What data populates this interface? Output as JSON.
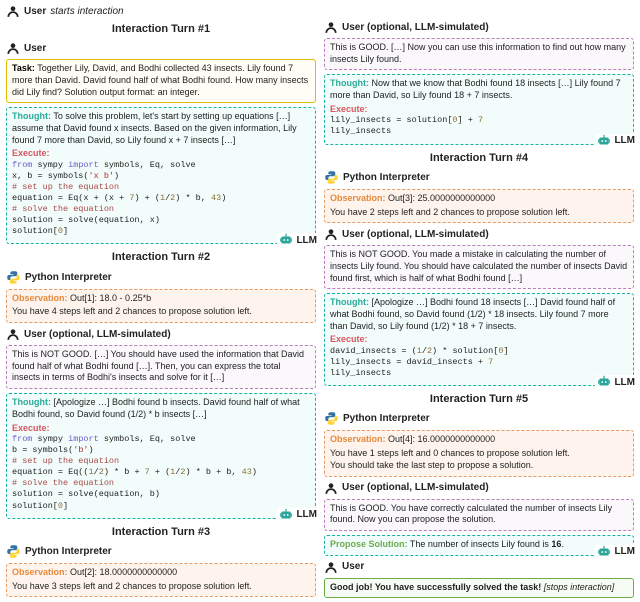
{
  "top": {
    "user_label": "User",
    "starts": "starts interaction"
  },
  "roles": {
    "user": "User",
    "llm": "LLM",
    "python": "Python Interpreter",
    "user_sim": "User (optional, LLM-simulated)"
  },
  "labels": {
    "task": "Task:",
    "thought": "Thought:",
    "execute": "Execute:",
    "observation": "Observation:",
    "propose": "Propose Solution:"
  },
  "turns": {
    "t1": "Interaction Turn #1",
    "t2": "Interaction Turn #2",
    "t3": "Interaction Turn #3",
    "t4": "Interaction Turn #4",
    "t5": "Interaction Turn #5"
  },
  "task": "Together Lily, David, and Bodhi collected 43 insects. Lily found 7 more than David. David found half of what Bodhi found. How many insects did Lily find? Solution output format: an integer.",
  "t1": {
    "thought": "To solve this problem, let's start by setting up equations […] assume that David found x insects. Based on the given information, Lily found 7 more than David, so Lily found x + 7 insects […]",
    "code": [
      {
        "t": "kw",
        "v": "from"
      },
      {
        "t": "p",
        "v": " sympy "
      },
      {
        "t": "kw",
        "v": "import"
      },
      {
        "t": "p",
        "v": " symbols, Eq, solve\n"
      },
      {
        "t": "p",
        "v": "x, b = symbols("
      },
      {
        "t": "str",
        "v": "'x b'"
      },
      {
        "t": "p",
        "v": ")\n"
      },
      {
        "t": "cmt",
        "v": "# set up the equation"
      },
      {
        "t": "p",
        "v": "\n"
      },
      {
        "t": "p",
        "v": "equation = Eq(x + (x + "
      },
      {
        "t": "num",
        "v": "7"
      },
      {
        "t": "p",
        "v": ") + ("
      },
      {
        "t": "num",
        "v": "1"
      },
      {
        "t": "p",
        "v": "/"
      },
      {
        "t": "num",
        "v": "2"
      },
      {
        "t": "p",
        "v": ") * b, "
      },
      {
        "t": "num",
        "v": "43"
      },
      {
        "t": "p",
        "v": ")\n"
      },
      {
        "t": "cmt",
        "v": "# solve the equation"
      },
      {
        "t": "p",
        "v": "\n"
      },
      {
        "t": "p",
        "v": "solution = solve(equation, x)\n"
      },
      {
        "t": "p",
        "v": "solution["
      },
      {
        "t": "num",
        "v": "0"
      },
      {
        "t": "p",
        "v": "]"
      }
    ]
  },
  "t2": {
    "obs": "Out[1]: 18.0 - 0.25*b",
    "steps": "You have 4 steps left and 2 chances to propose solution left.",
    "feedback": "This is NOT GOOD. […] You should have used the information that David found half of what Bodhi found […]. Then, you can express the total insects in terms of Bodhi's insects and solve for it […]",
    "thought": "[Apologize …] Bodhi found b insects. David found half of what Bodhi found, so David found (1/2) * b insects […]",
    "code": [
      {
        "t": "kw",
        "v": "from"
      },
      {
        "t": "p",
        "v": " sympy "
      },
      {
        "t": "kw",
        "v": "import"
      },
      {
        "t": "p",
        "v": " symbols, Eq, solve\n"
      },
      {
        "t": "p",
        "v": "b = symbols("
      },
      {
        "t": "str",
        "v": "'b'"
      },
      {
        "t": "p",
        "v": ")\n"
      },
      {
        "t": "cmt",
        "v": "# set up the equation"
      },
      {
        "t": "p",
        "v": "\n"
      },
      {
        "t": "p",
        "v": "equation = Eq(("
      },
      {
        "t": "num",
        "v": "1"
      },
      {
        "t": "p",
        "v": "/"
      },
      {
        "t": "num",
        "v": "2"
      },
      {
        "t": "p",
        "v": ") * b + "
      },
      {
        "t": "num",
        "v": "7"
      },
      {
        "t": "p",
        "v": " + ("
      },
      {
        "t": "num",
        "v": "1"
      },
      {
        "t": "p",
        "v": "/"
      },
      {
        "t": "num",
        "v": "2"
      },
      {
        "t": "p",
        "v": ") * b + b, "
      },
      {
        "t": "num",
        "v": "43"
      },
      {
        "t": "p",
        "v": ")\n"
      },
      {
        "t": "cmt",
        "v": "# solve the equation"
      },
      {
        "t": "p",
        "v": "\n"
      },
      {
        "t": "p",
        "v": "solution = solve(equation, b)\n"
      },
      {
        "t": "p",
        "v": "solution["
      },
      {
        "t": "num",
        "v": "0"
      },
      {
        "t": "p",
        "v": "]"
      }
    ]
  },
  "t3": {
    "obs": "Out[2]: 18.0000000000000",
    "steps": "You have 3 steps left and 2 chances to propose solution left.",
    "feedback": "This is GOOD. […] Now you can use this information to find out how many insects Lily found.",
    "thought": "Now that we know that Bodhi found 18 insects […] Lily found 7 more than David, so Lily found 18 + 7 insects.",
    "code": [
      {
        "t": "p",
        "v": "lily_insects = solution["
      },
      {
        "t": "num",
        "v": "0"
      },
      {
        "t": "p",
        "v": "] + "
      },
      {
        "t": "num",
        "v": "7"
      },
      {
        "t": "p",
        "v": "\n"
      },
      {
        "t": "p",
        "v": "lily_insects"
      }
    ]
  },
  "t4": {
    "obs": "Out[3]: 25.0000000000000",
    "steps": "You have 2 steps left and 2 chances to propose solution left.",
    "feedback": "This is NOT GOOD. You made a mistake in calculating the number of insects Lily found. You should have calculated the number of insects David found first, which is half of what Bodhi found […]",
    "thought": "[Apologize …] Bodhi found 18 insects […] David found half of what Bodhi found, so David found (1/2) * 18 insects. Lily found 7 more than David, so Lily found (1/2) * 18 + 7 insects.",
    "code": [
      {
        "t": "p",
        "v": "david_insects = ("
      },
      {
        "t": "num",
        "v": "1"
      },
      {
        "t": "p",
        "v": "/"
      },
      {
        "t": "num",
        "v": "2"
      },
      {
        "t": "p",
        "v": ") * solution["
      },
      {
        "t": "num",
        "v": "0"
      },
      {
        "t": "p",
        "v": "]\n"
      },
      {
        "t": "p",
        "v": "lily_insects = david_insects + "
      },
      {
        "t": "num",
        "v": "7"
      },
      {
        "t": "p",
        "v": "\n"
      },
      {
        "t": "p",
        "v": "lily_insects"
      }
    ]
  },
  "t5": {
    "obs": "Out[4]: 16.0000000000000",
    "steps1": "You have 1 steps left and 0 chances to propose solution left.",
    "steps2": "You should take the last step to propose a solution.",
    "feedback": "This is GOOD. You have correctly calculated the number of insects Lily found. Now you can propose the solution.",
    "propose_a": "The number of insects Lily found is ",
    "propose_b": "16",
    "propose_c": ".",
    "final_a": "Good job! You have successfully solved the task!",
    "final_b": "[stops interaction]"
  }
}
